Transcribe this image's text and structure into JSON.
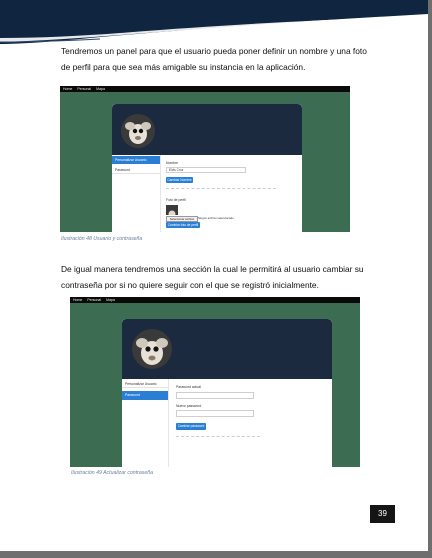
{
  "page": {
    "paragraph1": "Tendremos un panel para que el usuario pueda poner definir un nombre y una foto de perfil para que sea más amigable su instancia en la aplicación.",
    "caption1": "Ilustración 48 Usuario y contraseña",
    "paragraph2": "De igual manera tendremos una sección la cual le permitirá al usuario cambiar su contraseña por si no quiere seguir con el que se registró inicialmente.",
    "caption2": "Ilustración 49 Actualizar contraseña",
    "page_number": "39"
  },
  "screenshot1": {
    "nav": [
      "Home",
      "Personal",
      "Mapa"
    ],
    "sidebar": [
      "Personalizar Usuario",
      "Password"
    ],
    "name_label": "Nombre",
    "name_value": "Elvis Cruz",
    "name_button": "Cambiar Nombre",
    "photo_label": "Foto de perfil",
    "file_button": "Seleccionar archivo",
    "file_status": "Ningún archivo seleccionado",
    "photo_button": "Cambiar foto de perfil"
  },
  "screenshot2": {
    "nav": [
      "Home",
      "Personal",
      "Mapa"
    ],
    "sidebar": [
      "Personalizar Usuario",
      "Password"
    ],
    "current_label": "Password actual",
    "new_label": "Nuevo password",
    "button": "Cambiar password"
  },
  "colors": {
    "header_navy": "#0f2540",
    "header_accent": "#ffffff",
    "shot_background": "#3c6c52",
    "card_header": "#1c2a40",
    "primary_blue": "#2a7fd4"
  }
}
